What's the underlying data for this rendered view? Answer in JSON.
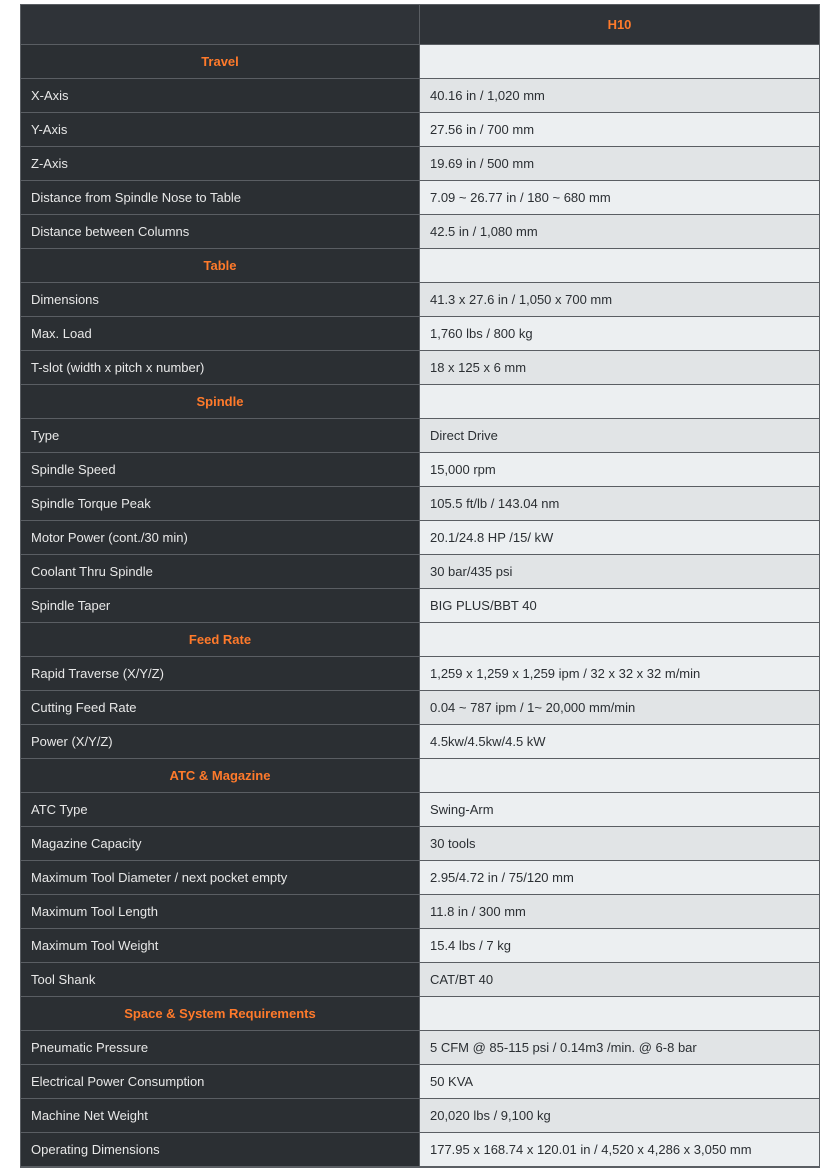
{
  "header": {
    "left": "",
    "right": "H10"
  },
  "sections": [
    {
      "title": "Travel",
      "rows": [
        {
          "label": "X-Axis",
          "value": "40.16 in / 1,020 mm"
        },
        {
          "label": "Y-Axis",
          "value": "27.56 in / 700 mm"
        },
        {
          "label": "Z-Axis",
          "value": "19.69 in / 500 mm"
        },
        {
          "label": "Distance from Spindle Nose to Table",
          "value": "7.09 ~ 26.77 in / 180 ~ 680 mm"
        },
        {
          "label": "Distance between Columns",
          "value": "42.5 in / 1,080 mm"
        }
      ]
    },
    {
      "title": "Table",
      "rows": [
        {
          "label": "Dimensions",
          "value": "41.3 x 27.6 in / 1,050 x 700 mm"
        },
        {
          "label": "Max. Load",
          "value": "1,760 lbs / 800 kg"
        },
        {
          "label": "T-slot (width x pitch x number)",
          "value": "18 x 125 x 6 mm"
        }
      ]
    },
    {
      "title": "Spindle",
      "rows": [
        {
          "label": "Type",
          "value": "Direct Drive"
        },
        {
          "label": "Spindle Speed",
          "value": "15,000 rpm"
        },
        {
          "label": "Spindle Torque Peak",
          "value": "105.5 ft/lb / 143.04 nm"
        },
        {
          "label": "Motor Power (cont./30 min)",
          "value": "20.1/24.8 HP /15/ kW"
        },
        {
          "label": "Coolant Thru Spindle",
          "value": "30 bar/435 psi"
        },
        {
          "label": "Spindle Taper",
          "value": "BIG PLUS/BBT 40"
        }
      ]
    },
    {
      "title": "Feed Rate",
      "rows": [
        {
          "label": "Rapid Traverse (X/Y/Z)",
          "value": "1,259 x 1,259 x 1,259 ipm / 32 x 32 x 32 m/min"
        },
        {
          "label": "Cutting Feed Rate",
          "value": "0.04 ~ 787 ipm / 1~ 20,000 mm/min"
        },
        {
          "label": "Power (X/Y/Z)",
          "value": "4.5kw/4.5kw/4.5 kW"
        }
      ]
    },
    {
      "title": "ATC & Magazine",
      "rows": [
        {
          "label": "ATC Type",
          "value": "Swing-Arm"
        },
        {
          "label": "Magazine Capacity",
          "value": "30 tools"
        },
        {
          "label": "Maximum Tool Diameter / next pocket empty",
          "value": "2.95/4.72 in / 75/120 mm"
        },
        {
          "label": "Maximum Tool Length",
          "value": "11.8 in / 300 mm"
        },
        {
          "label": "Maximum Tool Weight",
          "value": "15.4 lbs / 7 kg"
        },
        {
          "label": "Tool Shank",
          "value": "CAT/BT 40"
        }
      ]
    },
    {
      "title": "Space & System Requirements",
      "rows": [
        {
          "label": "Pneumatic Pressure",
          "value": "5 CFM @ 85-115 psi / 0.14m3 /min. @ 6-8 bar"
        },
        {
          "label": "Electrical Power Consumption",
          "value": "50 KVA"
        },
        {
          "label": "Machine Net Weight",
          "value": "20,020 lbs / 9,100 kg"
        },
        {
          "label": "Operating Dimensions",
          "value": "177.95 x 168.74 x 120.01 in / 4,520 x 4,286 x 3,050 mm"
        }
      ]
    }
  ]
}
